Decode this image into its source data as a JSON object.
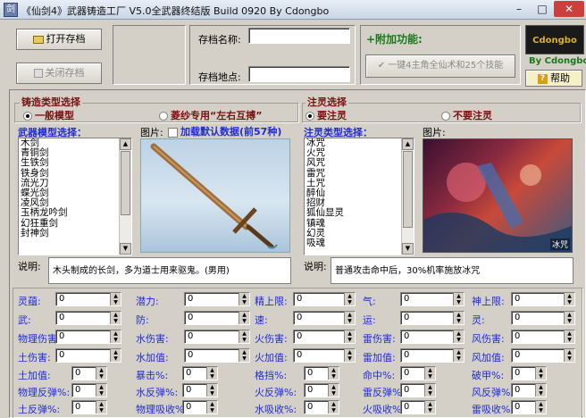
{
  "window": {
    "title": "《仙剑4》武器铸造工厂 V5.0全武器终结版 Build 0920 By Cdongbo",
    "minimize_glyph": "–",
    "maximize_glyph": "□",
    "close_glyph": "✕"
  },
  "toolbar": {
    "open_save_label": "打开存档",
    "close_save_label": "关闭存档",
    "save_name_label": "存档名称:",
    "save_name_value": "",
    "save_location_label": "存档地点:",
    "save_location_value": "",
    "extra_title": "+附加功能:",
    "one_click_label": "一键4主角全仙术和25个技能",
    "logo_text": "Cdongbo",
    "by_label": "By  Cdongbo",
    "help_label": "帮助"
  },
  "forge": {
    "group_title": "铸造类型选择",
    "radio_normal": "一般模型",
    "radio_linsha": "菱纱专用“左右互搏”",
    "models_label": "武器模型选择：",
    "picture_label": "图片:",
    "load_default_label": "加载默认数据(前57种)",
    "models": [
      "木剑",
      "青铜剑",
      "生铁剑",
      "铁身剑",
      "流光刀",
      "蝶光剑",
      "凌风剑",
      "玉柄龙吟剑",
      "幻狂重剑",
      "封神剑"
    ],
    "desc_label": "说明:",
    "desc_text": "木头制成的长剑，多为道士用来驱鬼。(男用)"
  },
  "spirit": {
    "group_title": "注灵选择",
    "radio_need": "要注灵",
    "radio_none": "不要注灵",
    "types_label": "注灵类型选择：",
    "picture_label": "图片:",
    "types": [
      "冰咒",
      "火咒",
      "风咒",
      "雷咒",
      "土咒",
      "醉仙",
      "招财",
      "狐仙显灵",
      "镇魂",
      "幻灵",
      "吸魂"
    ],
    "picture_caption": "冰咒",
    "desc_label": "说明:",
    "desc_text": "普通攻击命中后，30%机率施放冰咒"
  },
  "stats": {
    "row1": [
      {
        "label": "灵蕴:",
        "value": "0"
      },
      {
        "label": "潜力:",
        "value": "0"
      },
      {
        "label": "精上限:",
        "value": "0"
      },
      {
        "label": "气:",
        "value": "0"
      },
      {
        "label": "神上限:",
        "value": "0"
      }
    ],
    "row2": [
      {
        "label": "武:",
        "value": "0"
      },
      {
        "label": "防:",
        "value": "0"
      },
      {
        "label": "速:",
        "value": "0"
      },
      {
        "label": "运:",
        "value": "0"
      },
      {
        "label": "灵:",
        "value": "0"
      }
    ],
    "row3": [
      {
        "label": "物理伤害:",
        "value": "0"
      },
      {
        "label": "水伤害:",
        "value": "0"
      },
      {
        "label": "火伤害:",
        "value": "0"
      },
      {
        "label": "雷伤害:",
        "value": "0"
      },
      {
        "label": "风伤害:",
        "value": "0"
      }
    ],
    "row4": [
      {
        "label": "土伤害:",
        "value": "0"
      },
      {
        "label": "水加值:",
        "value": "0"
      },
      {
        "label": "火加值:",
        "value": "0"
      },
      {
        "label": "雷加值:",
        "value": "0"
      },
      {
        "label": "风加值:",
        "value": "0"
      }
    ],
    "row5": [
      {
        "label": "土加值:",
        "value": "0"
      },
      {
        "label": "暴击%:",
        "value": "0"
      },
      {
        "label": "格挡%:",
        "value": "0"
      },
      {
        "label": "命中%:",
        "value": "0"
      },
      {
        "label": "破甲%:",
        "value": "0"
      }
    ],
    "row6": [
      {
        "label": "物理反弹%:",
        "value": "0"
      },
      {
        "label": "水反弹%:",
        "value": "0"
      },
      {
        "label": "火反弹%:",
        "value": "0"
      },
      {
        "label": "雷反弹%:",
        "value": "0"
      },
      {
        "label": "风反弹%:",
        "value": "0"
      }
    ],
    "row7": [
      {
        "label": "土反弹%:",
        "value": "0"
      },
      {
        "label": "物理吸收%:",
        "value": "0"
      },
      {
        "label": "水吸收%:",
        "value": "0"
      },
      {
        "label": "火吸收%:",
        "value": "0"
      },
      {
        "label": "雷吸收%:",
        "value": "0"
      }
    ]
  },
  "colors": {
    "label_blue": "#1f2bd8",
    "group_title": "#7a1010",
    "extra_green": "#1a7a1a",
    "logo_bg": "#1a1a1a",
    "logo_text": "#e0b020"
  }
}
